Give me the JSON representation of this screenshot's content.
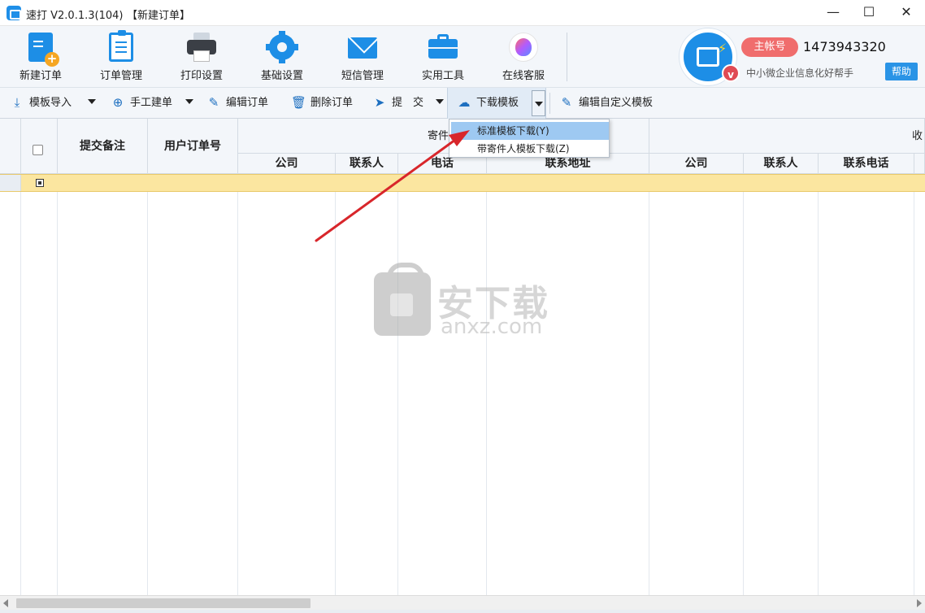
{
  "window": {
    "title": "速打 V2.0.1.3(104)",
    "doc_title": "【新建订单】",
    "controls": {
      "minimize": "—",
      "maximize": "☐",
      "close": "✕"
    }
  },
  "main_toolbar": {
    "items": [
      {
        "label": "新建订单",
        "icon": "new-order-icon"
      },
      {
        "label": "订单管理",
        "icon": "clipboard-icon"
      },
      {
        "label": "打印设置",
        "icon": "printer-icon"
      },
      {
        "label": "基础设置",
        "icon": "gear-icon"
      },
      {
        "label": "短信管理",
        "icon": "mail-icon"
      },
      {
        "label": "实用工具",
        "icon": "toolbox-icon"
      },
      {
        "label": "在线客服",
        "icon": "customer-service-icon"
      }
    ]
  },
  "account": {
    "badge": "主帐号",
    "number": "1473943320",
    "vip": "v",
    "slogan": "中小微企业信息化好帮手",
    "help": "帮助"
  },
  "sub_toolbar": {
    "import_template": "模板导入",
    "manual_order": "手工建单",
    "edit_order": "编辑订单",
    "delete_order": "删除订单",
    "submit": "提　交",
    "download_template": "下载模板",
    "edit_custom_template": "编辑自定义模板"
  },
  "download_menu": {
    "items": [
      "标准模板下载(Y)",
      "带寄件人模板下载(Z)"
    ]
  },
  "grid": {
    "headers": {
      "submit_note": "提交备注",
      "user_order_no": "用户订单号",
      "sender_group": "寄件人",
      "receiver_group": "收"
    },
    "sub_headers": [
      "公司",
      "联系人",
      "电话",
      "联系地址",
      "公司",
      "联系人",
      "联系电话"
    ]
  },
  "watermark": {
    "cn": "安下载",
    "en": "anxz.com"
  },
  "colors": {
    "accent": "#1d8ee6",
    "toolbar_bg": "#f3f6fa",
    "badge": "#f06d6d",
    "selected_row": "#fbe6a0",
    "menu_highlight": "#9ec9f2",
    "arrow": "#d8262b"
  }
}
